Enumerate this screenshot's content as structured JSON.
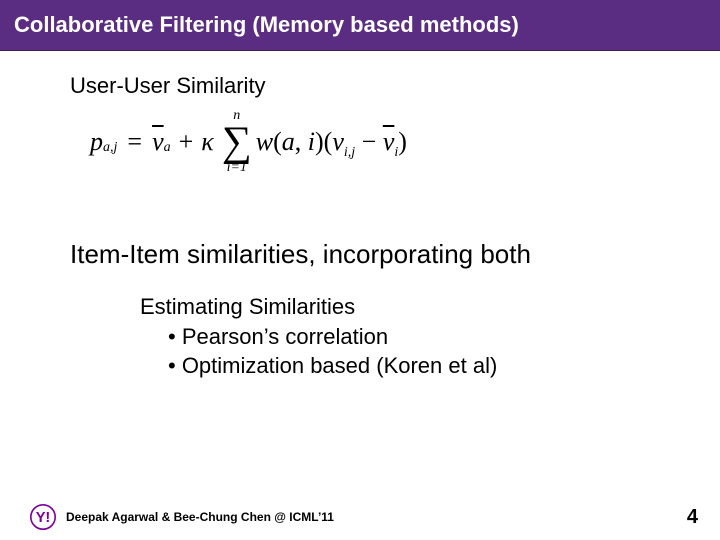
{
  "title": "Collaborative Filtering (Memory based methods)",
  "section1": "User-User Similarity",
  "formula": {
    "lhs_p": "p",
    "lhs_sub": "a,j",
    "eq": "=",
    "vbar_a": "v",
    "vbar_a_sub": "a",
    "plus": "+",
    "kappa": "κ",
    "sigma_top": "n",
    "sigma": "∑",
    "sigma_bot": "i=1",
    "w": "w",
    "w_args_open": "(",
    "w_arg1": "a",
    "w_comma": ", ",
    "w_arg2": "i",
    "w_args_close": ")",
    "paren_open": "(",
    "v": "v",
    "v_sub": "i,j",
    "minus": " − ",
    "vbar_i": "v",
    "vbar_i_sub": "i",
    "paren_close": ")"
  },
  "section2": "Item-Item similarities, incorporating both",
  "est": {
    "heading": "Estimating Similarities",
    "b1": "• Pearson’s correlation",
    "b2": "• Optimization based (Koren et al)"
  },
  "footer": {
    "credit": "Deepak Agarwal & Bee-Chung Chen @ ICML’11",
    "page": "4"
  }
}
